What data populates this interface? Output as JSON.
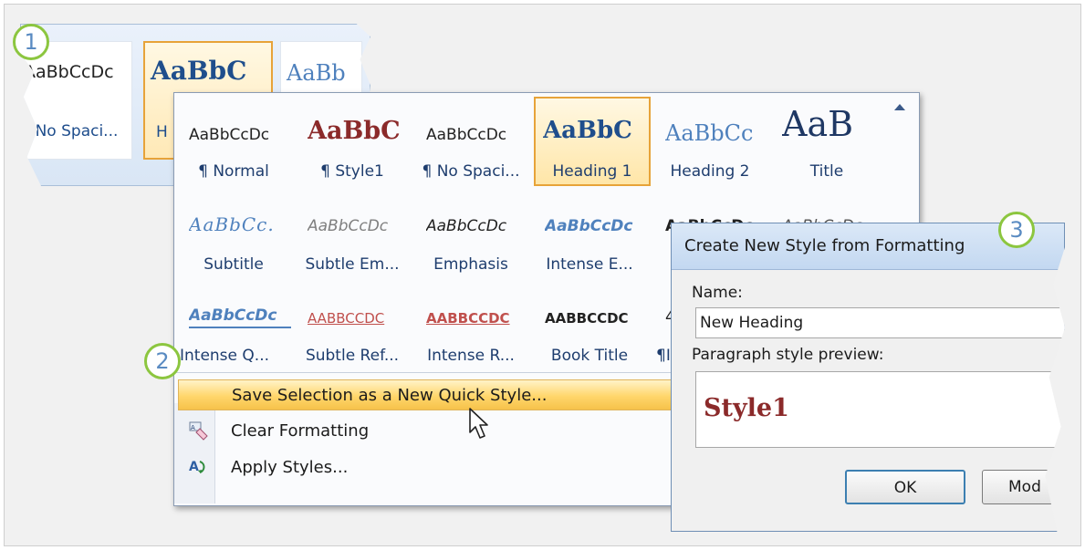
{
  "callouts": [
    "1",
    "2",
    "3"
  ],
  "ribbon": {
    "items": [
      {
        "sample": "AaBbCcDc",
        "label": "No Spaci..."
      },
      {
        "sample": "AaBbC",
        "label": "H"
      },
      {
        "sample": "AaBb",
        "label": ""
      }
    ]
  },
  "gallery": {
    "rows": [
      [
        {
          "sample": "AaBbCcDc",
          "label": "¶ Normal"
        },
        {
          "sample": "AaBbC",
          "label": "¶ Style1"
        },
        {
          "sample": "AaBbCcDc",
          "label": "¶ No Spaci..."
        },
        {
          "sample": "AaBbC",
          "label": "Heading 1"
        },
        {
          "sample": "AaBbCc",
          "label": "Heading 2"
        },
        {
          "sample": "AaB",
          "label": "Title"
        }
      ],
      [
        {
          "sample": "AaBbCc.",
          "label": "Subtitle"
        },
        {
          "sample": "AaBbCcDc",
          "label": "Subtle Em..."
        },
        {
          "sample": "AaBbCcDc",
          "label": "Emphasis"
        },
        {
          "sample": "AaBbCcDc",
          "label": "Intense E..."
        },
        {
          "sample": "AaBbCcDc",
          "label": ""
        },
        {
          "sample": "AaBbCcDc",
          "label": ""
        }
      ],
      [
        {
          "sample": "AaBbCcDc",
          "label": "Intense Q..."
        },
        {
          "sample": "AABBCCDC",
          "label": "Subtle Ref..."
        },
        {
          "sample": "AABBCCDC",
          "label": "Intense R..."
        },
        {
          "sample": "AABBCCDC",
          "label": "Book Title"
        },
        {
          "sample": "4",
          "label": "¶I"
        },
        {
          "sample": "",
          "label": ""
        }
      ]
    ],
    "menu": {
      "save": "Save Selection as a New Quick Style...",
      "clear": "Clear Formatting",
      "apply": "Apply Styles..."
    }
  },
  "dialog": {
    "title": "Create New Style from Formatting",
    "name_label": "Name:",
    "name_value": "New Heading",
    "preview_label": "Paragraph style preview:",
    "preview_text": "Style1",
    "ok": "OK",
    "modify": "Mod"
  },
  "colors": {
    "accent": "#e7a339",
    "callout_ring": "#8cc63f",
    "callout_text": "#5a8bc2",
    "preview_text": "#8b2a2a"
  }
}
